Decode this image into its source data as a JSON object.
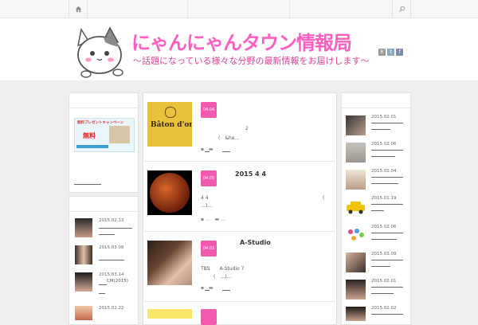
{
  "site": {
    "title": "にゃんにゃんタウン情報局",
    "subtitle": "〜話題になっている様々な分野の最新情報をお届けします〜"
  },
  "nav": {
    "icons": [
      "home-icon",
      "search-icon"
    ]
  },
  "social": [
    "rss-icon",
    "twitter-icon",
    "facebook-icon"
  ],
  "left_sidebar": {
    "banner": {
      "heading": "無料プレゼントキャンペーン",
      "highlight": "無料"
    },
    "recent": [
      {
        "date": "2015.02.13",
        "caption": ""
      },
      {
        "date": "2015.03.08",
        "caption": ""
      },
      {
        "date": "2015.03.14",
        "caption": "CM(2015)"
      },
      {
        "date": "2015.02.22",
        "caption": ""
      }
    ]
  },
  "posts": [
    {
      "badge": "04.04",
      "title": "",
      "text_line1": "2",
      "text_line2": "(　&he...",
      "meta": [
        "",
        ""
      ],
      "image": "Bâton d'or"
    },
    {
      "badge": "04.05",
      "title": "2015  4  4",
      "text_line1": "4 4",
      "text_line2": "…)…",
      "text_right": "(",
      "meta": [
        "...",
        "..."
      ]
    },
    {
      "badge": "04.02",
      "title": "A-Studio",
      "text_line1": "TBS　　A-Studio  7",
      "text_line2": "(　…)…",
      "meta": [
        "",
        ""
      ]
    },
    {
      "badge": "",
      "title": ""
    }
  ],
  "right_sidebar": {
    "items": [
      {
        "date": "2015.02.01"
      },
      {
        "date": "2015.02.06"
      },
      {
        "date": "2015.02.04"
      },
      {
        "date": "2015.01.19"
      },
      {
        "date": "2015.02.06"
      },
      {
        "date": "2015.03.09"
      },
      {
        "date": "2015.02.01"
      },
      {
        "date": "2015.02.02"
      }
    ]
  }
}
